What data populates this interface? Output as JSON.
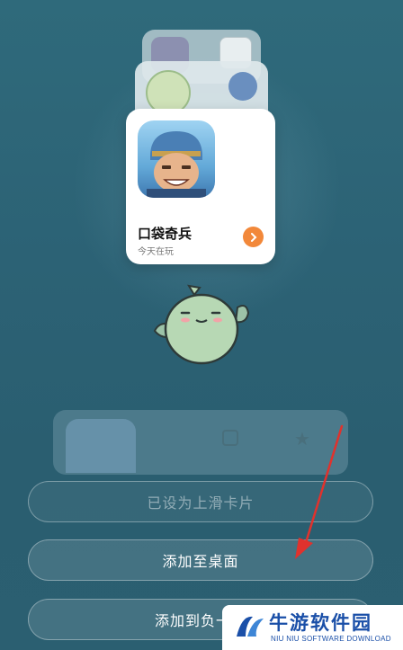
{
  "featured_card": {
    "game_name": "口袋奇兵",
    "status_text": "今天在玩"
  },
  "buttons": {
    "set_card_label": "已设为上滑卡片",
    "add_desktop_label": "添加至桌面",
    "add_negative_one_label": "添加到负一屏"
  },
  "watermark": {
    "title": "牛游软件园",
    "subtitle": "NIU NIU SOFTWARE DOWNLOAD"
  },
  "colors": {
    "accent_orange": "#f2883a",
    "annotation_red": "#e0322d",
    "watermark_blue": "#1a4fa8"
  }
}
